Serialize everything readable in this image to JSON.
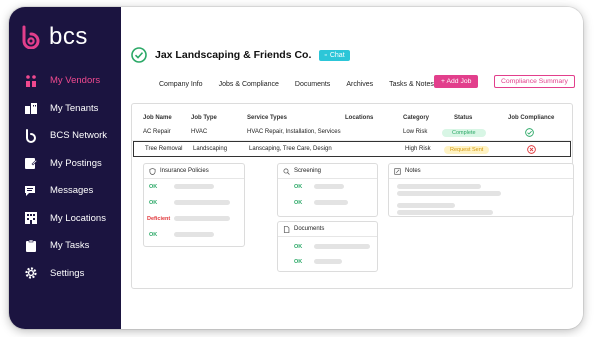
{
  "brand": {
    "name": "bcs",
    "accent": "#e23f8c",
    "sidebar_bg": "#1b1440"
  },
  "sidebar": {
    "items": [
      {
        "label": "My Vendors",
        "icon": "vendors-icon",
        "active": true
      },
      {
        "label": "My Tenants",
        "icon": "tenants-icon"
      },
      {
        "label": "BCS Network",
        "icon": "bcs-network-icon"
      },
      {
        "label": "My Postings",
        "icon": "postings-icon"
      },
      {
        "label": "Messages",
        "icon": "messages-icon"
      },
      {
        "label": "My Locations",
        "icon": "locations-icon"
      },
      {
        "label": "My Tasks",
        "icon": "tasks-icon"
      },
      {
        "label": "Settings",
        "icon": "gear-icon"
      }
    ]
  },
  "company": {
    "name": "Jax Landscaping & Friends Co.",
    "chat_label": "Chat"
  },
  "tabs": [
    "Company Info",
    "Jobs & Compliance",
    "Documents",
    "Archives",
    "Tasks & Notes"
  ],
  "actions": {
    "add_job": "+ Add Job",
    "compliance_summary": "Compliance Summary"
  },
  "jobs": {
    "headers": [
      "Job Name",
      "Job Type",
      "Service Types",
      "Locations",
      "Category",
      "Status",
      "Job Compliance"
    ],
    "rows": [
      {
        "name": "AC Repair",
        "type": "HVAC",
        "services": "HVAC Repair, Installation, Services",
        "locations": "",
        "category": "Low Risk",
        "status": "Complete",
        "compliance": "compliant"
      },
      {
        "name": "Tree Removal",
        "type": "Landscaping",
        "services": "Lanscaping, Tree Care, Design",
        "locations": "",
        "category": "High Risk",
        "status": "Request Sent",
        "compliance": "non-compliant"
      }
    ]
  },
  "cards": {
    "insurance": {
      "title": "Insurance Policies",
      "statuses": [
        "OK",
        "OK",
        "Deficient",
        "OK"
      ]
    },
    "screening": {
      "title": "Screening",
      "statuses": [
        "OK",
        "OK"
      ]
    },
    "documents": {
      "title": "Documents",
      "statuses": [
        "OK",
        "OK"
      ]
    },
    "notes": {
      "title": "Notes"
    }
  },
  "colors": {
    "ok": "#2aa866",
    "deficient": "#e0363a",
    "complete_bg": "#d8f6e5",
    "sent_bg": "#fff3c4",
    "chat": "#2cc6d8"
  }
}
